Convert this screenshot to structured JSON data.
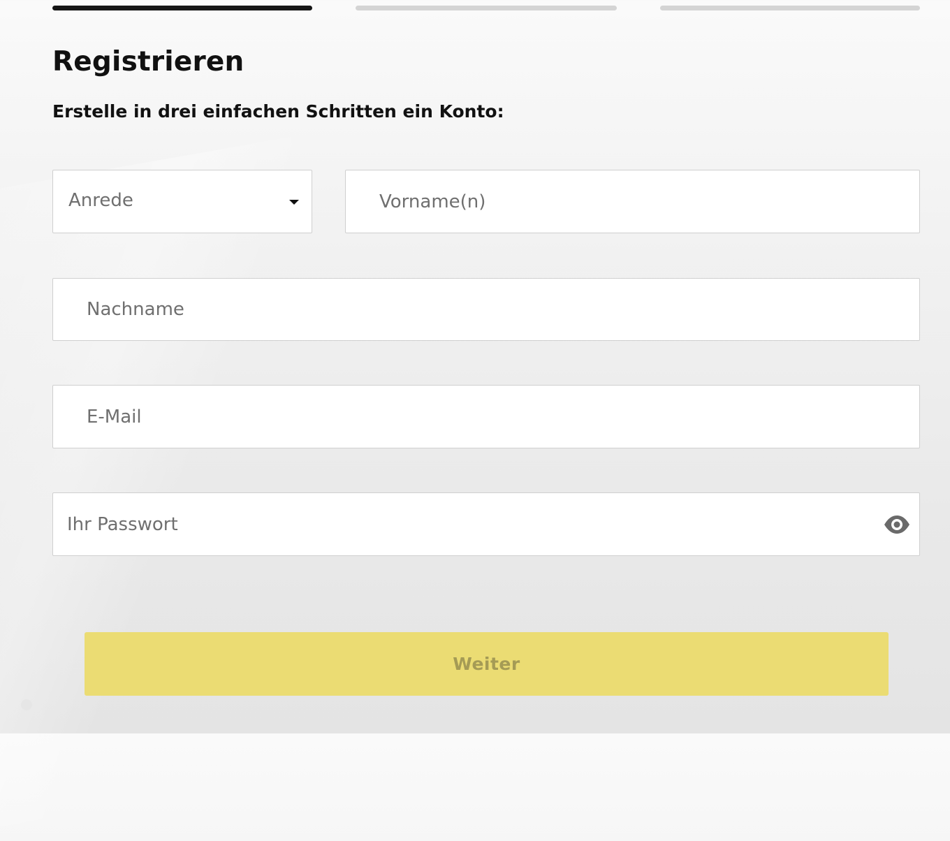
{
  "progress": {
    "current_step": 1,
    "total_steps": 3
  },
  "header": {
    "title": "Registrieren",
    "subtitle": "Erstelle in drei einfachen Schritten ein Konto:"
  },
  "form": {
    "salutation": {
      "placeholder": "Anrede"
    },
    "first_name": {
      "value": "",
      "placeholder": "Vorname(n)"
    },
    "last_name": {
      "value": "",
      "placeholder": "Nachname"
    },
    "email": {
      "value": "",
      "placeholder": "E-Mail"
    },
    "password": {
      "value": "",
      "placeholder": "Ihr Passwort",
      "toggle_icon": "eye-icon"
    },
    "next_label": "Weiter"
  },
  "colors": {
    "accent": "#ebdc73",
    "button_text_disabled": "#a59b55",
    "progress_active": "#151515",
    "progress_inactive": "#d4d4d4"
  }
}
